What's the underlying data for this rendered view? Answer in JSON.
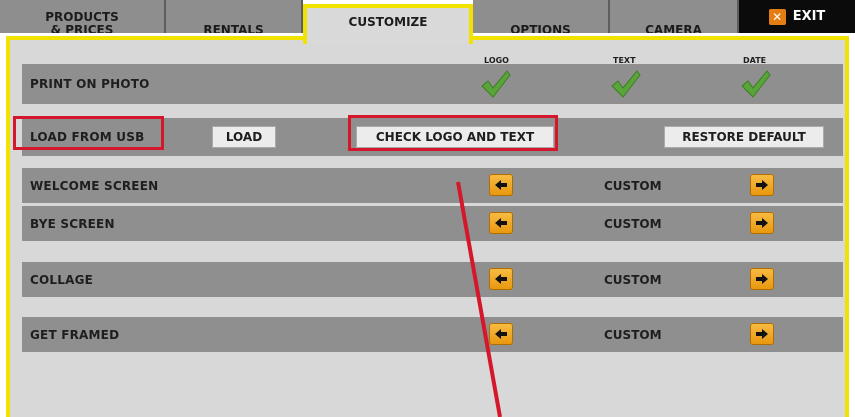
{
  "tabs": [
    {
      "label_line1": "PRODUCTS",
      "label_line2": "& PRICES"
    },
    {
      "label": "RENTALS"
    },
    {
      "label": "CUSTOMIZE"
    },
    {
      "label": "OPTIONS"
    },
    {
      "label": "CAMERA"
    }
  ],
  "exit": {
    "label": "EXIT",
    "icon": "close-icon"
  },
  "print_on_photo": {
    "label": "PRINT ON PHOTO",
    "columns": [
      {
        "header": "LOGO",
        "checked": true
      },
      {
        "header": "TEXT",
        "checked": true
      },
      {
        "header": "DATE",
        "checked": true
      }
    ]
  },
  "load_row": {
    "label": "LOAD FROM USB",
    "load_button": "LOAD",
    "check_button": "CHECK LOGO AND TEXT",
    "restore_button": "RESTORE DEFAULT"
  },
  "screens": [
    {
      "label": "WELCOME SCREEN",
      "value": "CUSTOM"
    },
    {
      "label": "BYE SCREEN",
      "value": "CUSTOM"
    },
    {
      "label": "COLLAGE",
      "value": "CUSTOM"
    },
    {
      "label": "GET FRAMED",
      "value": "CUSTOM"
    }
  ],
  "colors": {
    "highlight_yellow": "#f1e200",
    "annotation_red": "#d4172a",
    "arrow_orange": "#f0a52a",
    "check_green": "#5aa53a"
  }
}
